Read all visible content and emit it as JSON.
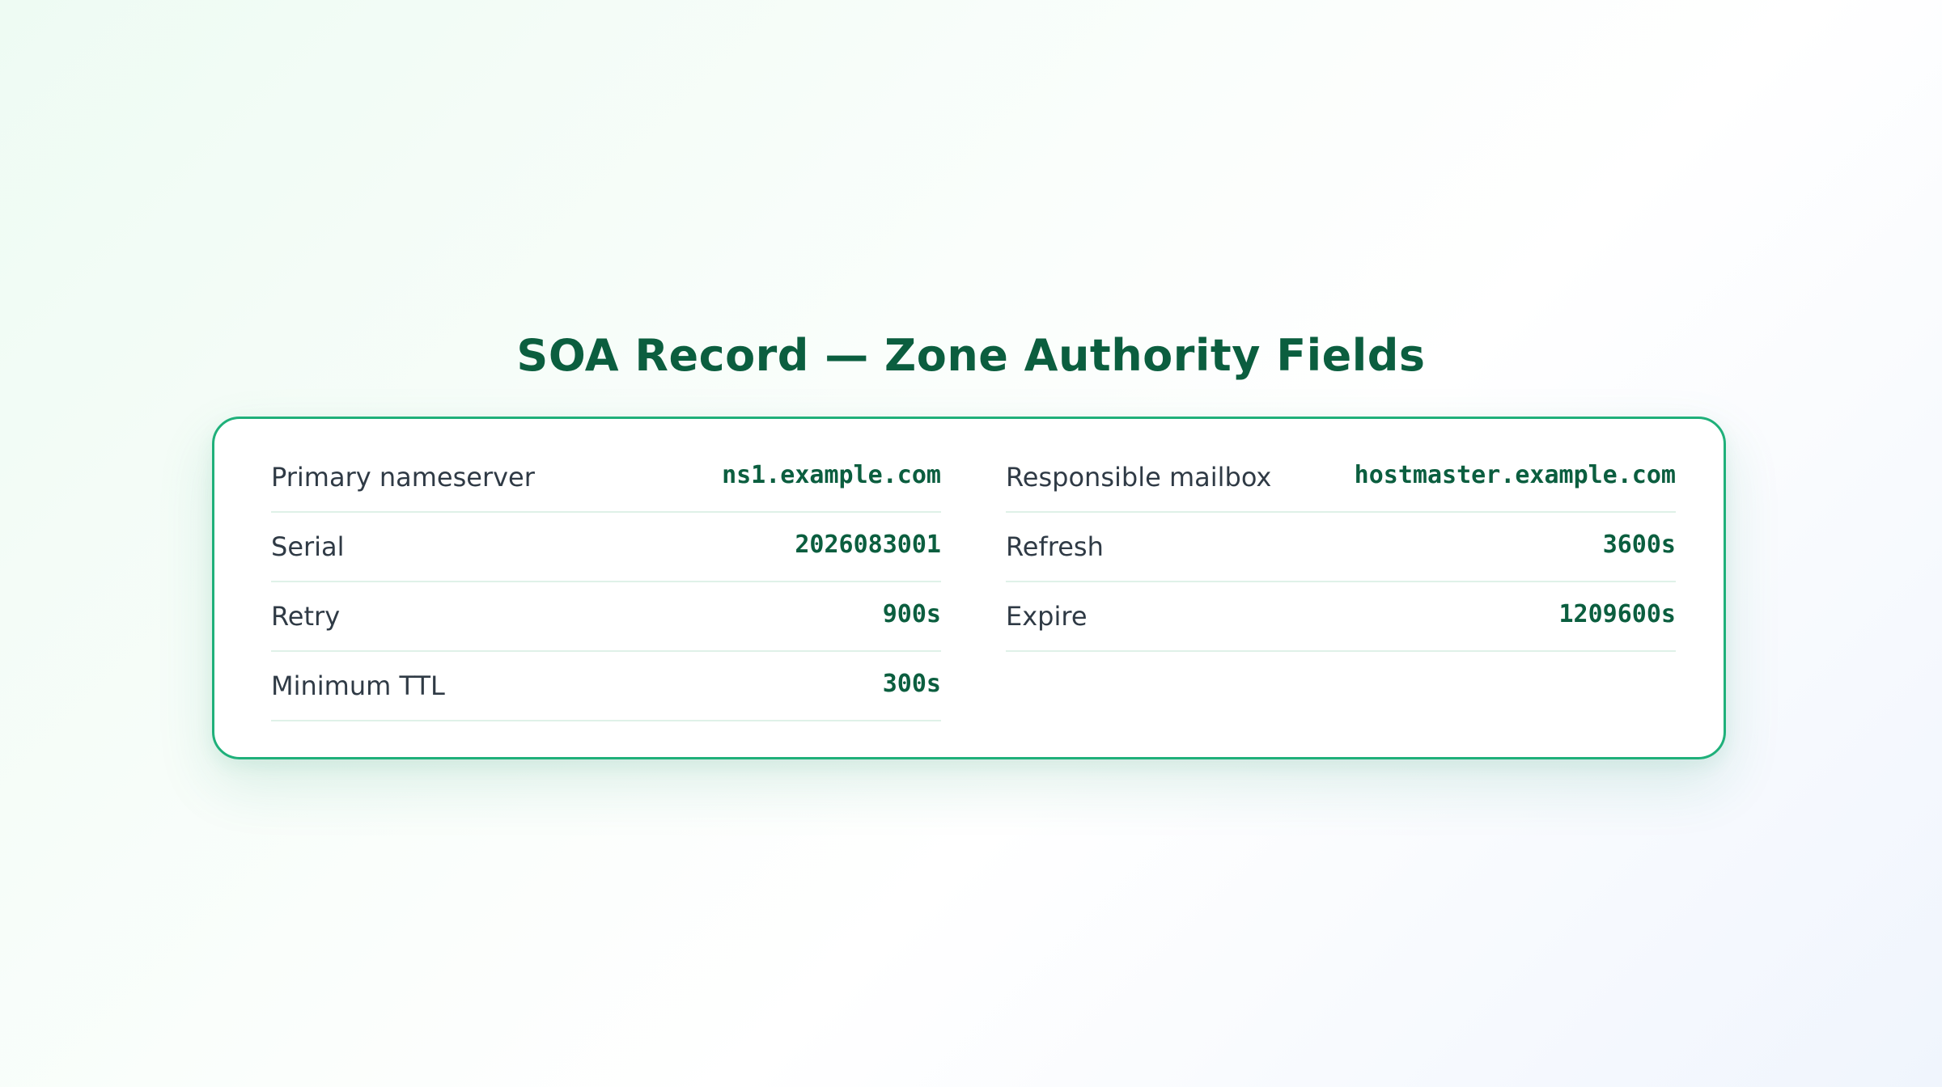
{
  "title": "SOA Record — Zone Authority Fields",
  "fields": [
    {
      "label": "Primary nameserver",
      "value": "ns1.example.com"
    },
    {
      "label": "Responsible mailbox",
      "value": "hostmaster.example.com"
    },
    {
      "label": "Serial",
      "value": "2026083001"
    },
    {
      "label": "Refresh",
      "value": "3600s"
    },
    {
      "label": "Retry",
      "value": "900s"
    },
    {
      "label": "Expire",
      "value": "1209600s"
    },
    {
      "label": "Minimum TTL",
      "value": "300s"
    }
  ],
  "colors": {
    "accent": "#1fb07a",
    "title": "#0b5e3f",
    "value": "#0b5e3f",
    "label": "#2f3a45",
    "divider": "#dff1e8"
  }
}
